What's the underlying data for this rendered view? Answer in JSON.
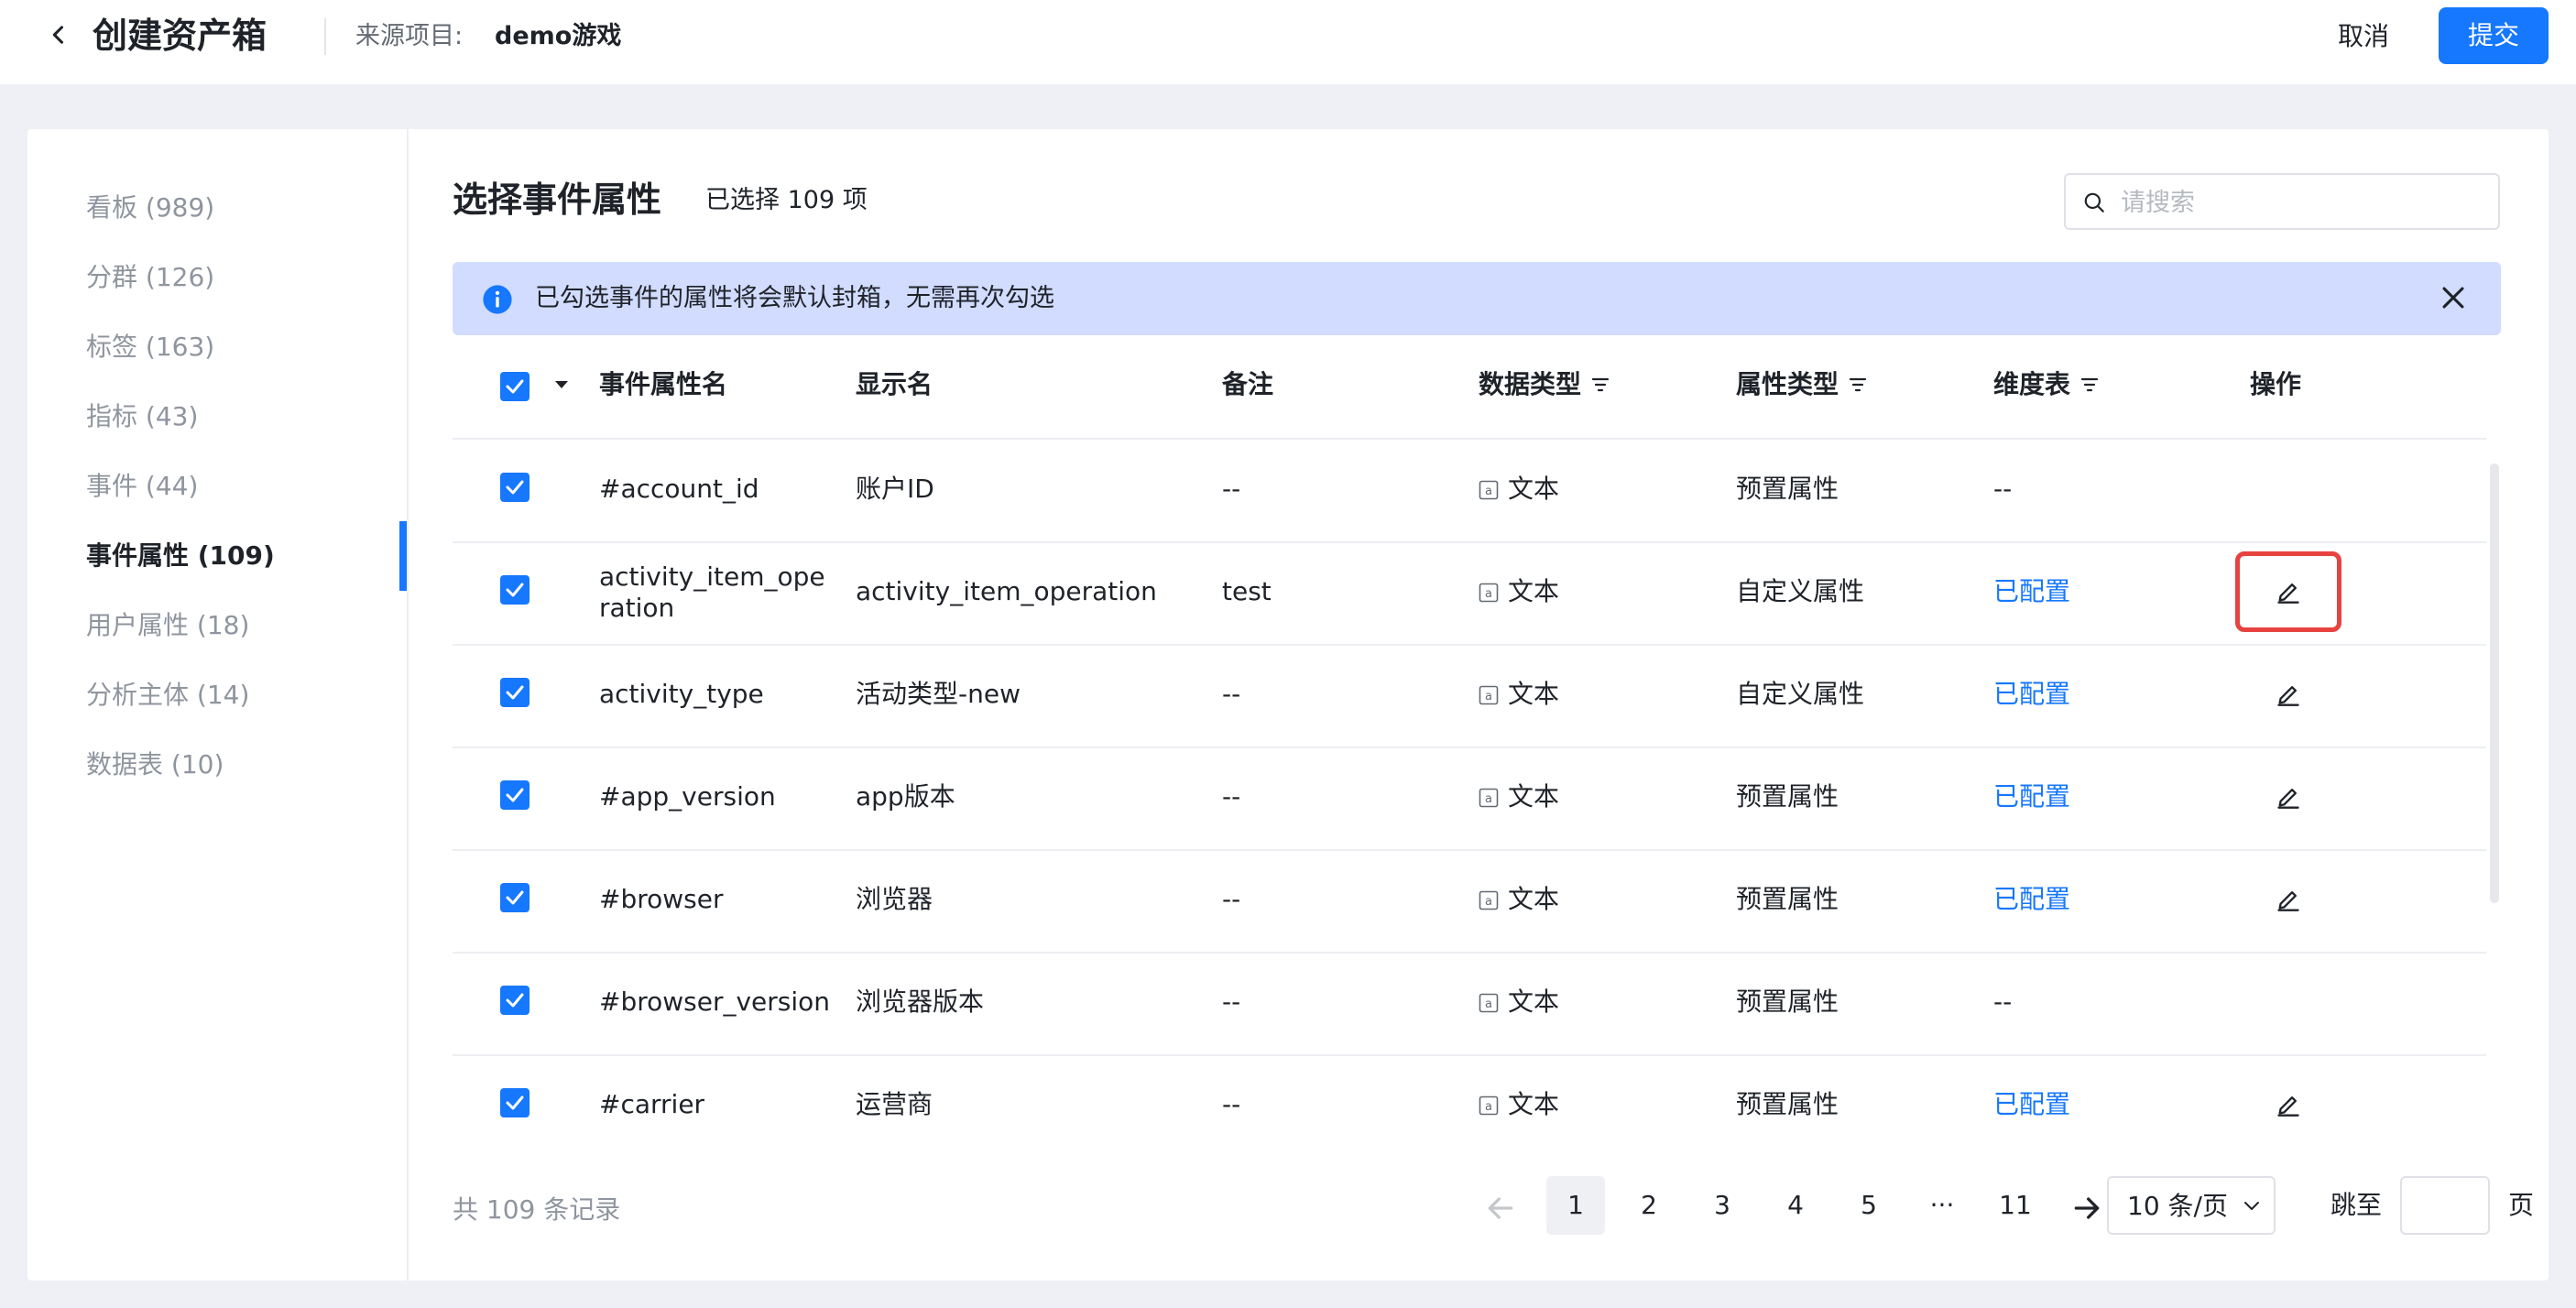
{
  "header": {
    "title": "创建资产箱",
    "source_label": "来源项目:",
    "source_value": "demo游戏",
    "cancel_label": "取消",
    "submit_label": "提交"
  },
  "sidebar": {
    "items": [
      {
        "label": "看板 (989)",
        "active": false
      },
      {
        "label": "分群 (126)",
        "active": false
      },
      {
        "label": "标签 (163)",
        "active": false
      },
      {
        "label": "指标 (43)",
        "active": false
      },
      {
        "label": "事件 (44)",
        "active": false
      },
      {
        "label": "事件属性 (109)",
        "active": true
      },
      {
        "label": "用户属性 (18)",
        "active": false
      },
      {
        "label": "分析主体 (14)",
        "active": false
      },
      {
        "label": "数据表 (10)",
        "active": false
      }
    ]
  },
  "main": {
    "title": "选择事件属性",
    "selected_count": "已选择 109 项",
    "search": {
      "placeholder": "请搜索",
      "value": ""
    },
    "banner": {
      "text": "已勾选事件的属性将会默认封箱，无需再次勾选"
    },
    "table": {
      "columns": {
        "name": "事件属性名",
        "display": "显示名",
        "note": "备注",
        "data_type": "数据类型",
        "attr_type": "属性类型",
        "dim_table": "维度表",
        "action": "操作"
      },
      "rows": [
        {
          "name": "#account_id",
          "display": "账户ID",
          "note": "--",
          "data_type": "文本",
          "attr_type": "预置属性",
          "dim_table": "--",
          "editable": false,
          "checked": true
        },
        {
          "name": "activity_item_operation",
          "display": "activity_item_operation",
          "note": "test",
          "data_type": "文本",
          "attr_type": "自定义属性",
          "dim_table": "已配置",
          "editable": true,
          "checked": true,
          "highlighted": true
        },
        {
          "name": "activity_type",
          "display": "活动类型-new",
          "note": "--",
          "data_type": "文本",
          "attr_type": "自定义属性",
          "dim_table": "已配置",
          "editable": true,
          "checked": true
        },
        {
          "name": "#app_version",
          "display": "app版本",
          "note": "--",
          "data_type": "文本",
          "attr_type": "预置属性",
          "dim_table": "已配置",
          "editable": true,
          "checked": true
        },
        {
          "name": "#browser",
          "display": "浏览器",
          "note": "--",
          "data_type": "文本",
          "attr_type": "预置属性",
          "dim_table": "已配置",
          "editable": true,
          "checked": true
        },
        {
          "name": "#browser_version",
          "display": "浏览器版本",
          "note": "--",
          "data_type": "文本",
          "attr_type": "预置属性",
          "dim_table": "--",
          "editable": false,
          "checked": true
        },
        {
          "name": "#carrier",
          "display": "运营商",
          "note": "--",
          "data_type": "文本",
          "attr_type": "预置属性",
          "dim_table": "已配置",
          "editable": true,
          "checked": true
        }
      ]
    },
    "pagination": {
      "total_text": "共 109 条记录",
      "pages": [
        "1",
        "2",
        "3",
        "4",
        "5",
        "···",
        "11"
      ],
      "current_page": "1",
      "page_size": "10 条/页",
      "jump_label": "跳至",
      "jump_value": "",
      "page_unit": "页"
    }
  },
  "colors": {
    "accent": "#1677ff",
    "banner_bg": "#d1dcff",
    "highlight": "#e8423f",
    "background": "#eff0f5"
  },
  "icons": {
    "back": "chevron-left-icon",
    "search": "search-icon",
    "info": "info-icon",
    "close": "close-icon",
    "filter": "filter-icon",
    "edit": "edit-pencil-icon",
    "text_type": "text-type-icon",
    "prev": "arrow-left-icon",
    "next": "arrow-right-icon"
  }
}
